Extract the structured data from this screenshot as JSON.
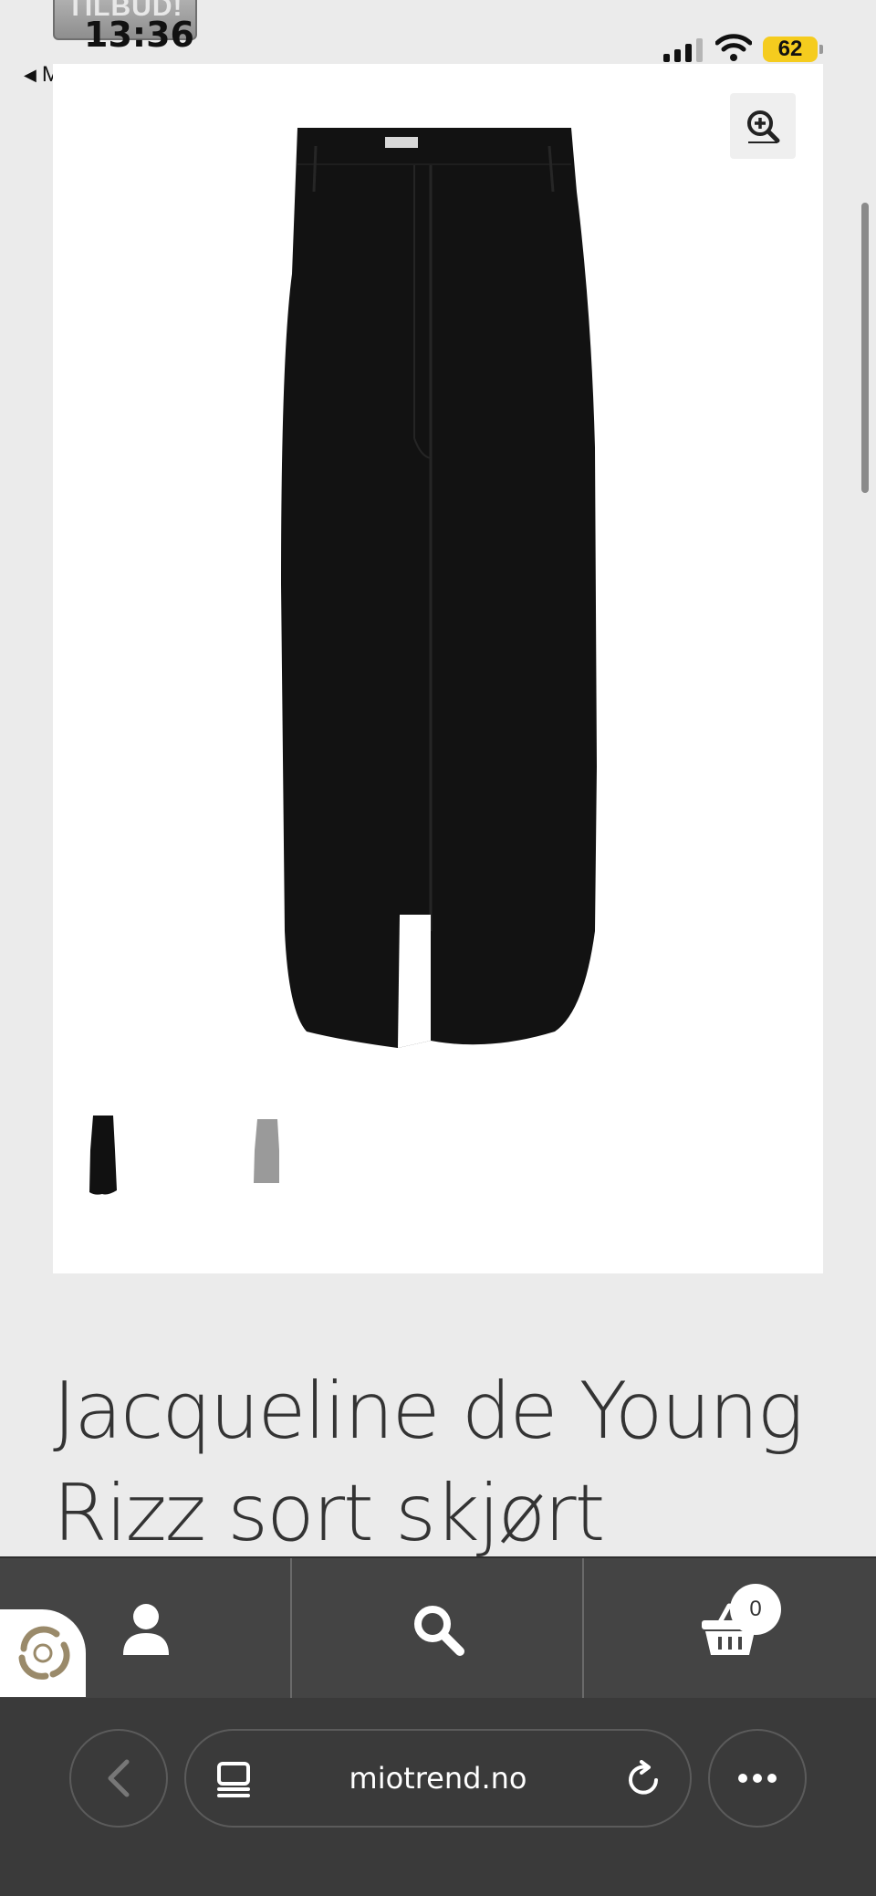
{
  "status_bar": {
    "promo_badge": "TILBUD!",
    "time": "13:36",
    "back_label": "Mail",
    "battery": "62"
  },
  "product": {
    "title_line1": "Jacqueline de Young",
    "title_line2": "Rizz sort skjørt",
    "images": [
      "skirt-black-front"
    ],
    "thumbnails": [
      "black",
      "grey"
    ]
  },
  "site_nav": {
    "cart_count": "0",
    "icons": [
      "user-icon",
      "search-icon",
      "basket-icon"
    ]
  },
  "browser": {
    "url": "miotrend.no"
  },
  "colors": {
    "nav_bg": "#444444",
    "browser_bg": "#3a3a3a",
    "battery": "#f5cc1e",
    "page_bg": "#ebebeb"
  }
}
